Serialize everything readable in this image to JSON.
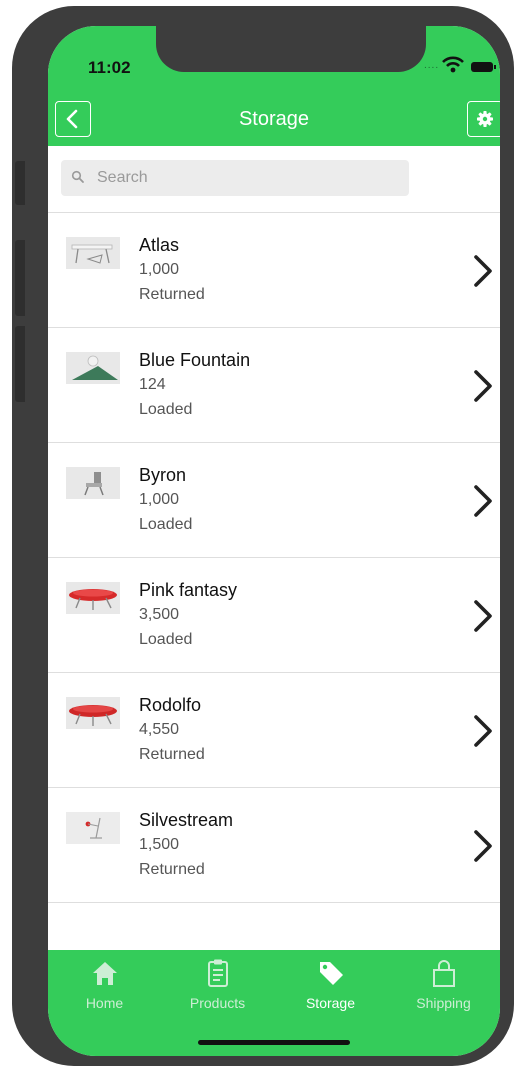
{
  "status_bar": {
    "time": "11:02",
    "signal_dots": "....",
    "wifi_icon": "wifi-icon",
    "battery_icon": "battery-icon"
  },
  "header": {
    "title": "Storage",
    "back_icon": "chevron-left-icon",
    "settings_icon": "gear-icon",
    "color": "#34cc5a"
  },
  "search": {
    "placeholder": "Search"
  },
  "items": [
    {
      "name": "Atlas",
      "quantity": "1,000",
      "status": "Returned",
      "thumbnail": "desk"
    },
    {
      "name": "Blue Fountain",
      "quantity": "124",
      "status": "Loaded",
      "thumbnail": "lamp"
    },
    {
      "name": "Byron",
      "quantity": "1,000",
      "status": "Loaded",
      "thumbnail": "chair"
    },
    {
      "name": "Pink fantasy",
      "quantity": "3,500",
      "status": "Loaded",
      "thumbnail": "red-table"
    },
    {
      "name": "Rodolfo",
      "quantity": "4,550",
      "status": "Returned",
      "thumbnail": "red-table"
    },
    {
      "name": "Silvestream",
      "quantity": "1,500",
      "status": "Returned",
      "thumbnail": "floor-lamp"
    }
  ],
  "tabbar": {
    "active": "Storage",
    "tabs": [
      {
        "label": "Home",
        "icon": "home-icon"
      },
      {
        "label": "Products",
        "icon": "clipboard-icon"
      },
      {
        "label": "Storage",
        "icon": "tag-icon"
      },
      {
        "label": "Shipping",
        "icon": "shopping-bag-icon"
      }
    ]
  }
}
